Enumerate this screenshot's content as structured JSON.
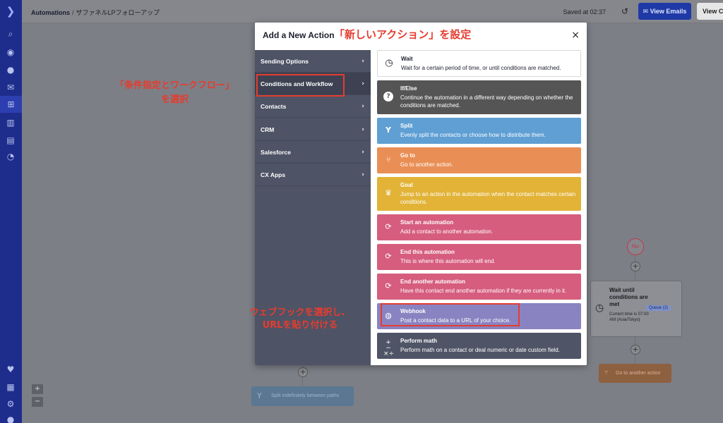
{
  "header": {
    "breadcrumb_root": "Automations",
    "breadcrumb_sep": "/",
    "breadcrumb_current": "ザファネルLPフォローアップ",
    "saved_text": "Saved at 02:37",
    "view_emails_label": "View Emails",
    "view_other_label": "View C"
  },
  "modal": {
    "title": "Add a New Action",
    "title_annotation": "「新しいアクション」を設定",
    "close_label": "×",
    "categories": [
      {
        "label": "Sending Options",
        "chevron": "›"
      },
      {
        "label": "Conditions and Workflow",
        "chevron": "›"
      },
      {
        "label": "Contacts",
        "chevron": "›"
      },
      {
        "label": "CRM",
        "chevron": "›"
      },
      {
        "label": "Salesforce",
        "chevron": "›"
      },
      {
        "label": "CX Apps",
        "chevron": "›"
      }
    ],
    "actions": [
      {
        "title": "Wait",
        "desc": "Wait for a certain period of time, or until conditions are matched.",
        "icon": "clock-icon",
        "color": "#ffffff"
      },
      {
        "title": "If/Else",
        "desc": "Continue the automation in a different way depending on whether the conditions are matched.",
        "icon": "question-icon",
        "color": "#555555"
      },
      {
        "title": "Split",
        "desc": "Evenly split the contacts or choose how to distribute them.",
        "icon": "split-icon",
        "color": "#5f9fd3"
      },
      {
        "title": "Go to",
        "desc": "Go to another action.",
        "icon": "branch-icon",
        "color": "#e98f56"
      },
      {
        "title": "Goal",
        "desc": "Jump to an action in the automation when the contact matches certain conditions.",
        "icon": "trophy-icon",
        "color": "#e2b337"
      },
      {
        "title": "Start an automation",
        "desc": "Add a contact to another automation.",
        "icon": "cycle-icon",
        "color": "#d65d7d"
      },
      {
        "title": "End this automation",
        "desc": "This is where this automation will end.",
        "icon": "cycle-icon",
        "color": "#d65d7d"
      },
      {
        "title": "End another automation",
        "desc": "Have this contact end another automation if they are currently in it.",
        "icon": "cycle-icon",
        "color": "#d65d7d"
      },
      {
        "title": "Webhook",
        "desc": "Post a contact data to a URL of your choice.",
        "icon": "globe-icon",
        "color": "#8a83c1"
      },
      {
        "title": "Perform math",
        "desc": "Perform math on a contact or deal numeric or date custom field.",
        "icon": "math-icon",
        "color": "#4f5566"
      }
    ]
  },
  "annotations": {
    "conditions_line1": "「条件指定とワークフロー」",
    "conditions_line2": "を選択",
    "webhook_line1": "ウェブフックを選択し、",
    "webhook_line2": "URLを貼り付ける"
  },
  "canvas": {
    "no_label": "No",
    "wait_title": "Wait until conditions are met",
    "wait_sub": "Current time is 07:00 AM (Asia/Tokyo)",
    "wait_badge": "Queue (2)",
    "goto_label": "Go to another action",
    "split_label": "Split indefinitely between paths",
    "zoom_in": "+",
    "zoom_out": "−"
  }
}
